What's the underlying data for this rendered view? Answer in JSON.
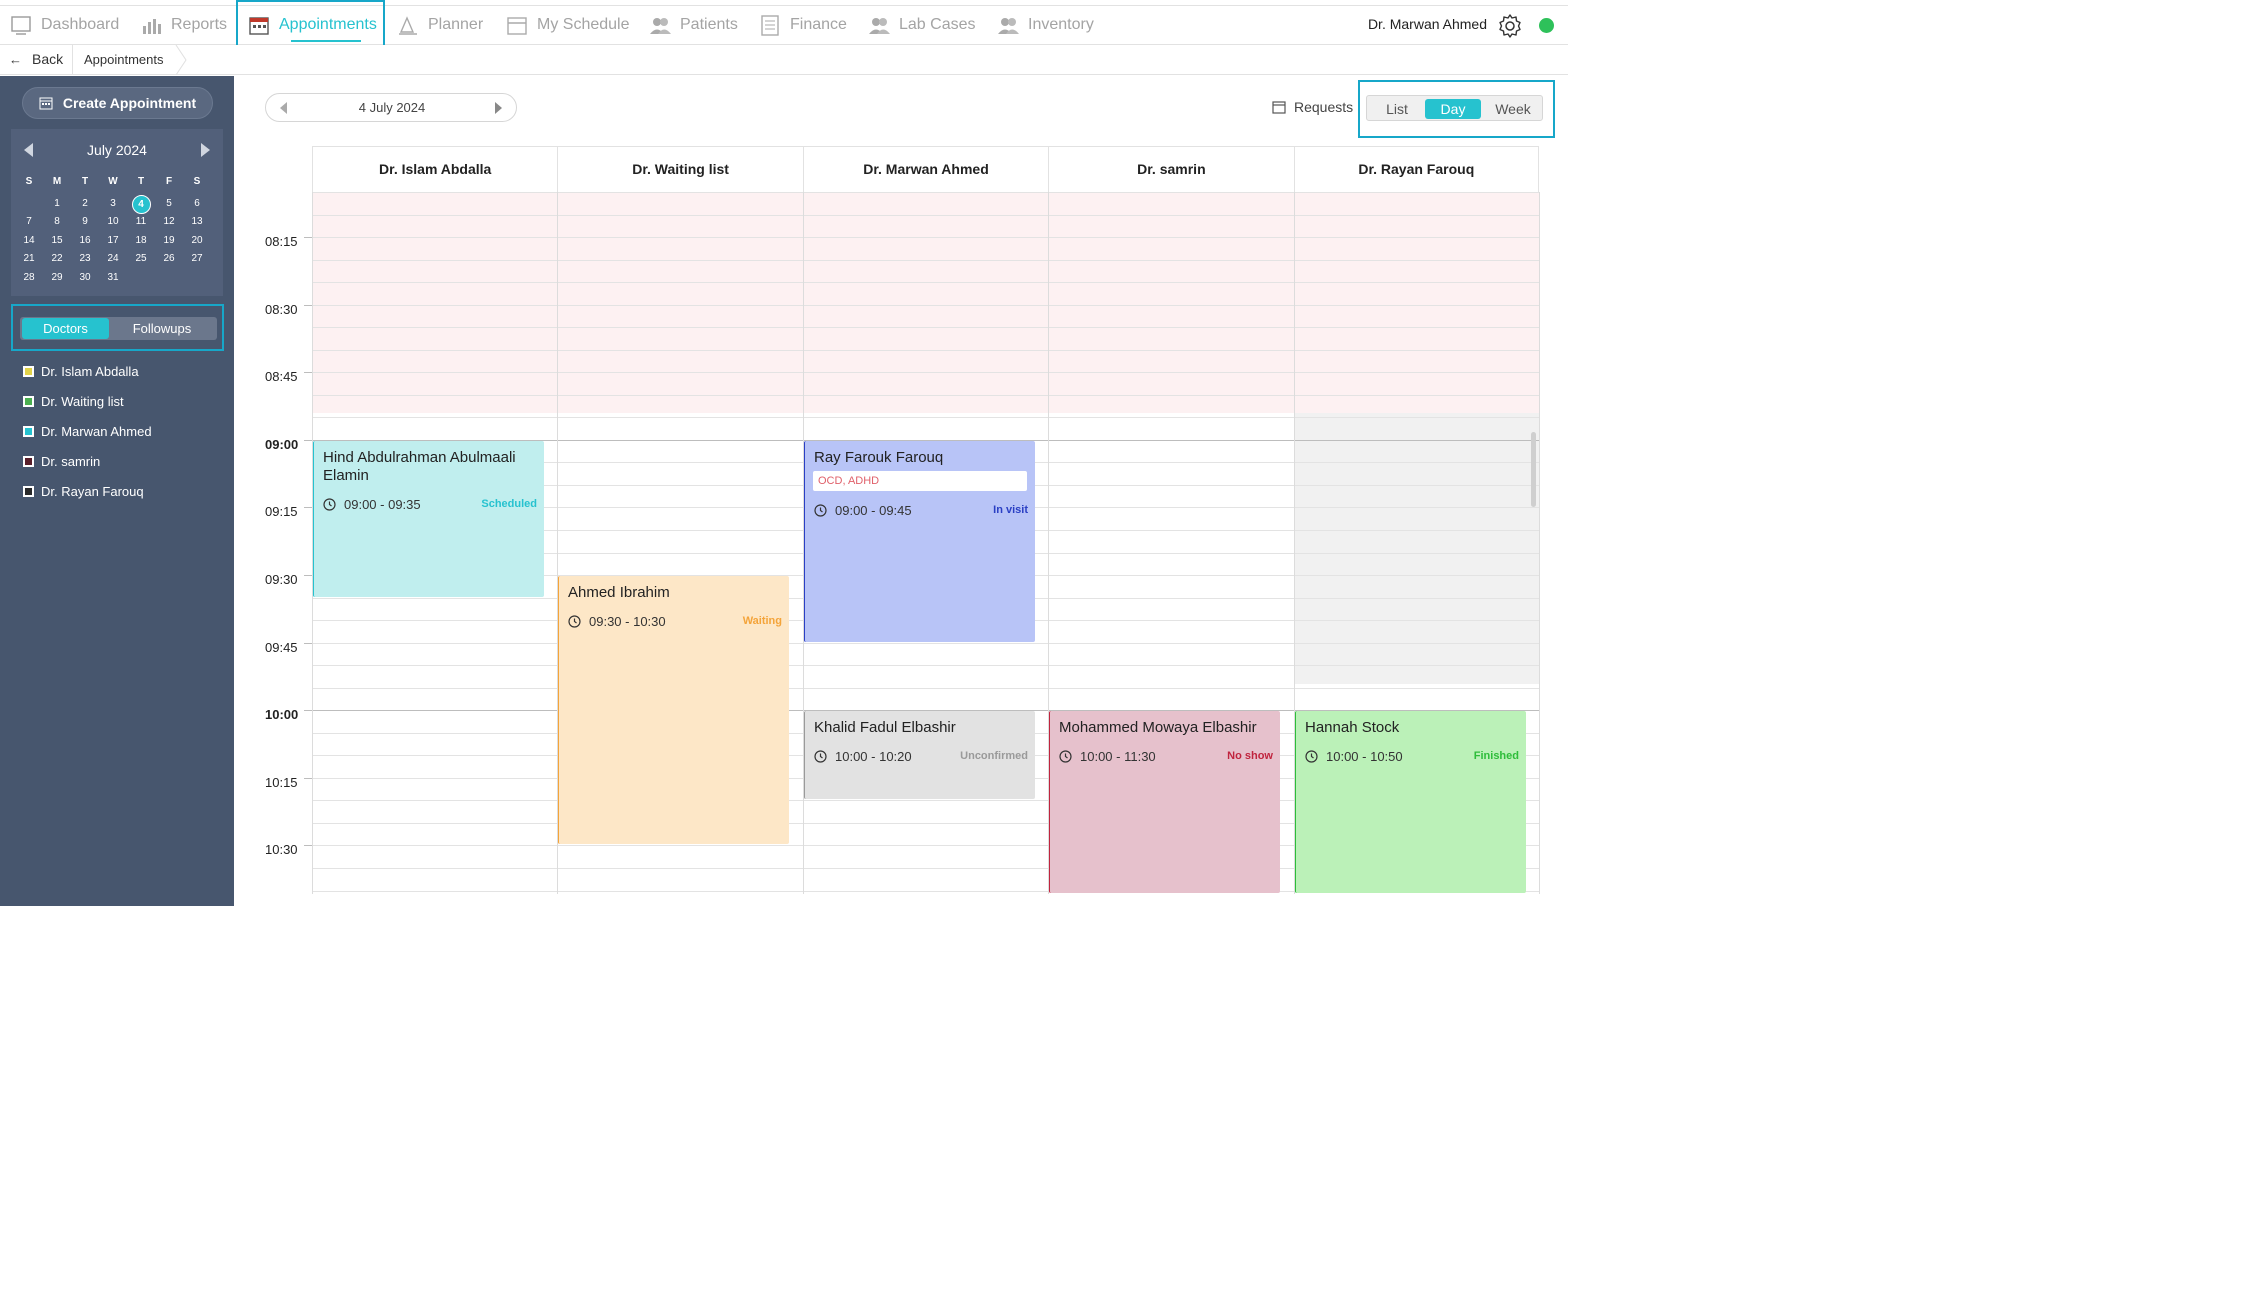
{
  "nav": {
    "items": [
      {
        "label": "Dashboard",
        "icon": "dashboard-icon"
      },
      {
        "label": "Reports",
        "icon": "reports-icon"
      },
      {
        "label": "Appointments",
        "icon": "appointments-icon",
        "active": true
      },
      {
        "label": "Planner",
        "icon": "planner-icon"
      },
      {
        "label": "My Schedule",
        "icon": "schedule-icon"
      },
      {
        "label": "Patients",
        "icon": "patients-icon"
      },
      {
        "label": "Finance",
        "icon": "finance-icon"
      },
      {
        "label": "Lab Cases",
        "icon": "lab-icon"
      },
      {
        "label": "Inventory",
        "icon": "inventory-icon"
      }
    ],
    "user": "Dr. Marwan Ahmed"
  },
  "breadcrumb": {
    "back": "Back",
    "current": "Appointments"
  },
  "sidebar": {
    "create_label": "Create Appointment",
    "calendar": {
      "month": "July 2024",
      "weekdays": [
        "S",
        "M",
        "T",
        "W",
        "T",
        "F",
        "S"
      ],
      "weeks": [
        [
          "",
          "1",
          "2",
          "3",
          "4",
          "5",
          "6"
        ],
        [
          "7",
          "8",
          "9",
          "10",
          "11",
          "12",
          "13"
        ],
        [
          "14",
          "15",
          "16",
          "17",
          "18",
          "19",
          "20"
        ],
        [
          "21",
          "22",
          "23",
          "24",
          "25",
          "26",
          "27"
        ],
        [
          "28",
          "29",
          "30",
          "31",
          "",
          "",
          ""
        ]
      ],
      "selected": "4"
    },
    "toggle": {
      "doctors": "Doctors",
      "followups": "Followups"
    },
    "doctors": [
      {
        "name": "Dr. Islam Abdalla",
        "color": "#e2d34a"
      },
      {
        "name": "Dr. Waiting list",
        "color": "#4caf50"
      },
      {
        "name": "Dr. Marwan Ahmed",
        "color": "#26c2cf"
      },
      {
        "name": "Dr. samrin",
        "color": "#5a1f2a"
      },
      {
        "name": "Dr. Rayan Farouq",
        "color": "#2a2a2a"
      }
    ]
  },
  "toolbar": {
    "date": "4 July 2024",
    "requests": "Requests",
    "views": [
      "List",
      "Day",
      "Week"
    ],
    "active_view": "Day"
  },
  "schedule": {
    "columns": [
      "Dr. Islam Abdalla",
      "Dr. Waiting list",
      "Dr. Marwan Ahmed",
      "Dr. samrin",
      "Dr. Rayan Farouq"
    ],
    "times": [
      {
        "label": "08:15",
        "hour": false
      },
      {
        "label": "08:30",
        "hour": false
      },
      {
        "label": "08:45",
        "hour": false
      },
      {
        "label": "09:00",
        "hour": true
      },
      {
        "label": "09:15",
        "hour": false
      },
      {
        "label": "09:30",
        "hour": false
      },
      {
        "label": "09:45",
        "hour": false
      },
      {
        "label": "10:00",
        "hour": true
      },
      {
        "label": "10:15",
        "hour": false
      },
      {
        "label": "10:30",
        "hour": false
      }
    ],
    "appointments": [
      {
        "column": 0,
        "patient": "Hind Abdulrahman Abulmaali Elamin",
        "time": "09:00 - 09:35",
        "start": "09:00",
        "end": "09:35",
        "status": "Scheduled",
        "bg": "#c0eeee",
        "status_color": "#26c2cf"
      },
      {
        "column": 1,
        "patient": "Ahmed Ibrahim",
        "time": "09:30 - 10:30",
        "start": "09:30",
        "end": "10:30",
        "status": "Waiting",
        "bg": "#fde7c7",
        "status_color": "#f4a43a"
      },
      {
        "column": 2,
        "patient": "Ray Farouk Farouq",
        "tags": "OCD, ADHD",
        "time": "09:00 - 09:45",
        "start": "09:00",
        "end": "09:45",
        "status": "In visit",
        "bg": "#b8c4f7",
        "status_color": "#2a3fc4"
      },
      {
        "column": 2,
        "patient": "Khalid Fadul Elbashir",
        "time": "10:00 - 10:20",
        "start": "10:00",
        "end": "10:20",
        "status": "Unconfirmed",
        "bg": "#e2e2e2",
        "status_color": "#9a9a9a"
      },
      {
        "column": 3,
        "patient": "Mohammed Mowaya Elbashir",
        "time": "10:00 - 11:30",
        "start": "10:00",
        "end": "11:30",
        "status": "No show",
        "bg": "#e6c1cc",
        "status_color": "#c0243e"
      },
      {
        "column": 4,
        "patient": "Hannah Stock",
        "time": "10:00 - 10:50",
        "start": "10:00",
        "end": "10:50",
        "status": "Finished",
        "bg": "#bbf1b8",
        "status_color": "#2ebd3a"
      }
    ]
  }
}
